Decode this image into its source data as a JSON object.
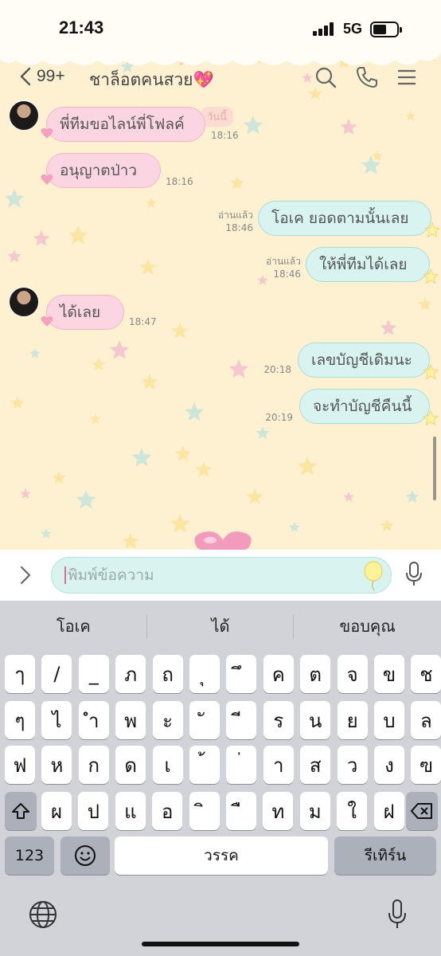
{
  "status_bar": {
    "time": "21:43",
    "network": "5G"
  },
  "header": {
    "unread_count": "99+",
    "title": "ชาล็อตคนสวย💖",
    "icons": [
      "search-icon",
      "phone-icon",
      "menu-icon"
    ]
  },
  "date_tag": "วันนี้",
  "messages": [
    {
      "side": "in",
      "text": "พี่ทีมขอไลน์พี่โฟลค์",
      "time": "18:16",
      "read": ""
    },
    {
      "side": "in",
      "text": "อนุญาตป่าว",
      "time": "18:16",
      "read": ""
    },
    {
      "side": "out",
      "text": "โอเค ยอดตามนั้นเลย",
      "time": "18:46",
      "read": "อ่านแล้ว"
    },
    {
      "side": "out",
      "text": "ให้พี่ทีมได้เลย",
      "time": "18:46",
      "read": "อ่านแล้ว"
    },
    {
      "side": "in",
      "text": "ได้เลย",
      "time": "18:47",
      "read": ""
    },
    {
      "side": "out",
      "text": "เลขบัญชีเดิมนะ",
      "time": "20:18",
      "read": ""
    },
    {
      "side": "out",
      "text": "จะทำบัญชีคืนนี้",
      "time": "20:19",
      "read": ""
    }
  ],
  "input": {
    "placeholder": "พิมพ์ข้อความ"
  },
  "suggestions": [
    "โอเค",
    "ได้",
    "ขอบคุณ"
  ],
  "keyboard": {
    "row1": [
      "ๅ",
      "/",
      "_",
      "ภ",
      "ถ",
      "ุ",
      "ึ",
      "ค",
      "ต",
      "จ",
      "ข",
      "ช"
    ],
    "row2": [
      "ๆ",
      "ไ",
      "ำ",
      "พ",
      "ะ",
      "ั",
      "ี",
      "ร",
      "น",
      "ย",
      "บ",
      "ล"
    ],
    "row3": [
      "ฟ",
      "ห",
      "ก",
      "ด",
      "เ",
      "้",
      "่",
      "า",
      "ส",
      "ว",
      "ง",
      "ฃ"
    ],
    "row4": [
      "ผ",
      "ป",
      "แ",
      "อ",
      "ิ",
      "ื",
      "ท",
      "ม",
      "ใ",
      "ฝ"
    ],
    "numbers_label": "123",
    "space_label": "วรรค",
    "return_label": "รีเทิร์น"
  },
  "colors": {
    "incoming_bubble": "#fbd5e2",
    "outgoing_bubble": "#d8f3f0",
    "background": "#fdf1d2"
  }
}
